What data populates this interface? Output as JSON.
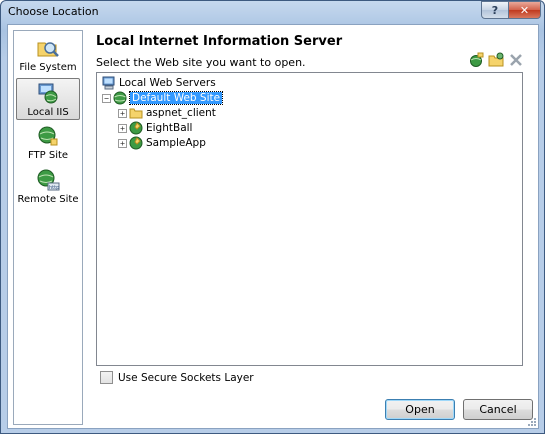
{
  "window": {
    "title": "Choose Location",
    "help_label": "?",
    "close_label": "✕"
  },
  "nav": {
    "items": [
      {
        "label": "File System",
        "icon": "file-system-icon",
        "selected": false
      },
      {
        "label": "Local IIS",
        "icon": "local-iis-icon",
        "selected": true
      },
      {
        "label": "FTP Site",
        "icon": "ftp-site-icon",
        "selected": false
      },
      {
        "label": "Remote Site",
        "icon": "remote-site-icon",
        "selected": false
      }
    ]
  },
  "main": {
    "heading": "Local Internet Information Server",
    "instruction": "Select the Web site you want to open.",
    "toolbar_icons": [
      "create-web-application-icon",
      "create-virtual-directory-icon",
      "delete-icon"
    ]
  },
  "tree": {
    "root": {
      "label": "Local Web Servers",
      "icon": "computer-icon"
    },
    "site": {
      "label": "Default Web Site",
      "icon": "globe-icon",
      "expander": "−",
      "selected": true
    },
    "children": [
      {
        "label": "aspnet_client",
        "icon": "folder-icon",
        "expander": "+"
      },
      {
        "label": "EightBall",
        "icon": "web-app-icon",
        "expander": "+"
      },
      {
        "label": "SampleApp",
        "icon": "web-app-icon",
        "expander": "+"
      }
    ]
  },
  "options": {
    "ssl_label": "Use Secure Sockets Layer",
    "ssl_checked": false
  },
  "buttons": {
    "open_label": "Open",
    "cancel_label": "Cancel"
  },
  "colors": {
    "selection": "#3399ff",
    "frame": "#b9cfe9"
  }
}
